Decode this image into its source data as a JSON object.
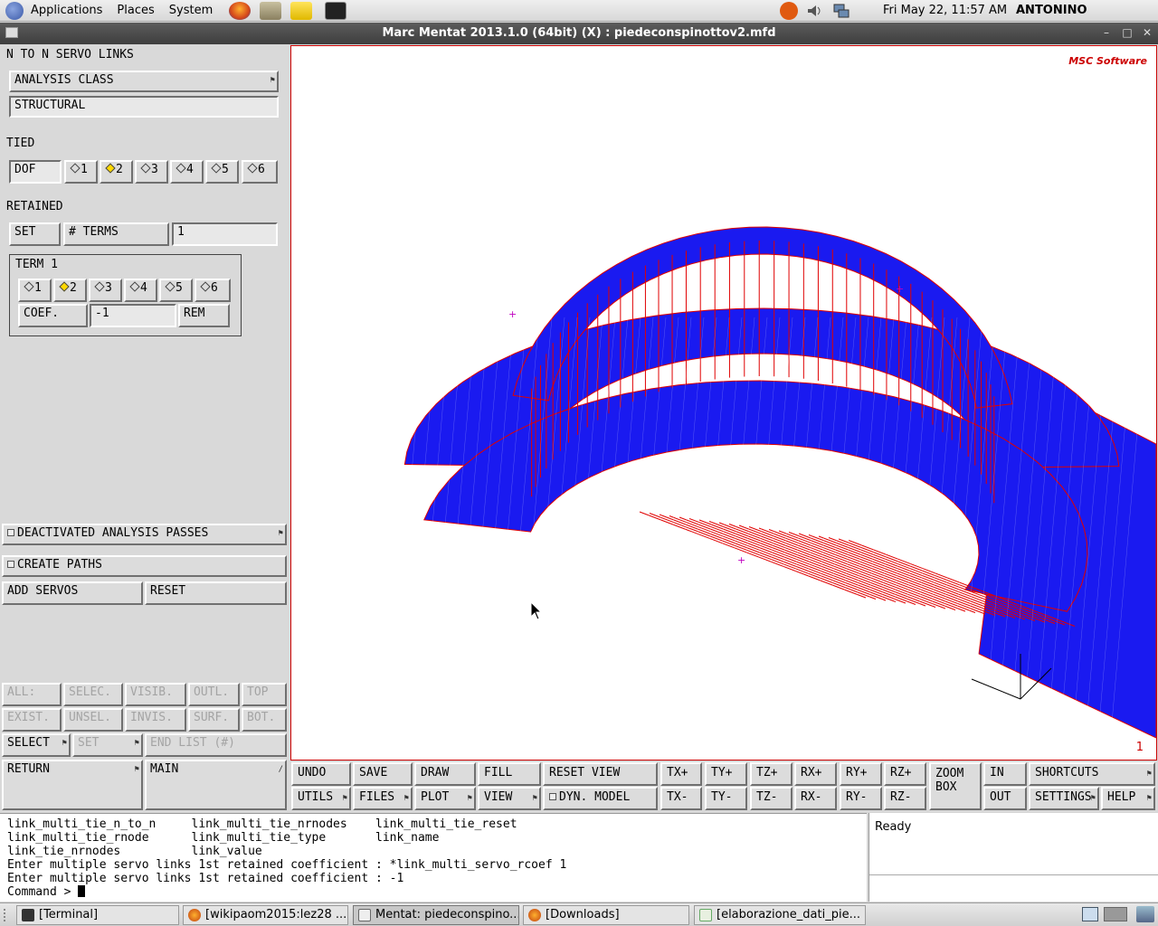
{
  "top_panel": {
    "menus": [
      "Applications",
      "Places",
      "System"
    ],
    "clock": "Fri May 22, 11:57 AM",
    "user": "ANTONINO RANDAZZO"
  },
  "window": {
    "title": "Marc Mentat 2013.1.0 (64bit) (X) : piedeconspinottov2.mfd",
    "controls": [
      "–",
      "□",
      "✕"
    ]
  },
  "left_panel": {
    "heading": "N TO N SERVO LINKS",
    "analysis_class_label": "ANALYSIS CLASS",
    "analysis_class_value": "STRUCTURAL",
    "tied_label": "TIED",
    "dof_label": "DOF",
    "tied_dofs": [
      "1",
      "2",
      "3",
      "4",
      "5",
      "6"
    ],
    "tied_selected": "2",
    "retained_label": "RETAINED",
    "set_label": "SET",
    "terms_label": "# TERMS",
    "terms_value": "1",
    "term_group_label": "TERM 1",
    "term_dofs": [
      "1",
      "2",
      "3",
      "4",
      "5",
      "6"
    ],
    "term_selected": "2",
    "coef_label": "COEF.",
    "coef_value": "-1",
    "rem_label": "REM",
    "deactivated_label": "DEACTIVATED ANALYSIS PASSES",
    "create_paths_label": "CREATE PATHS",
    "add_servos_label": "ADD SERVOS",
    "reset_label": "RESET",
    "sel_row1": [
      "ALL:",
      "SELEC.",
      "VISIB.",
      "OUTL.",
      "TOP"
    ],
    "sel_row2": [
      "EXIST.",
      "UNSEL.",
      "INVIS.",
      "SURF.",
      "BOT."
    ],
    "select_label": "SELECT",
    "set2_label": "SET",
    "end_list_label": "END LIST (#)",
    "return_label": "RETURN",
    "main_label": "MAIN"
  },
  "viewport": {
    "logo": "MSC Software",
    "frame_number": "1",
    "mesh_color": "#1a1af0",
    "link_color": "#e00000"
  },
  "toolbar": {
    "row1": [
      "UNDO",
      "SAVE",
      "DRAW",
      "FILL",
      "RESET VIEW",
      "TX+",
      "TY+",
      "TZ+",
      "RX+",
      "RY+",
      "RZ+"
    ],
    "row2": [
      "UTILS",
      "FILES",
      "PLOT",
      "VIEW",
      "DYN. MODEL",
      "TX-",
      "TY-",
      "TZ-",
      "RX-",
      "RY-",
      "RZ-"
    ],
    "zoom_box": "ZOOM BOX",
    "in": "IN",
    "out": "OUT",
    "shortcuts": "SHORTCUTS",
    "settings": "SETTINGS",
    "help": "HELP"
  },
  "command": {
    "lines": [
      "link_multi_tie_n_to_n     link_multi_tie_nrnodes    link_multi_tie_reset",
      "link_multi_tie_rnode      link_multi_tie_type       link_name",
      "link_tie_nrnodes          link_value",
      "Enter multiple servo links 1st retained coefficient : *link_multi_servo_rcoef 1",
      "Enter multiple servo links 1st retained coefficient : -1"
    ],
    "prompt": "Command > ",
    "status": "Ready"
  },
  "taskbar": {
    "tasks": [
      "[Terminal]",
      "[wikipaom2015:lez28 ...",
      "Mentat: piedeconspino...",
      "[Downloads]",
      "[elaborazione_dati_pie..."
    ]
  }
}
